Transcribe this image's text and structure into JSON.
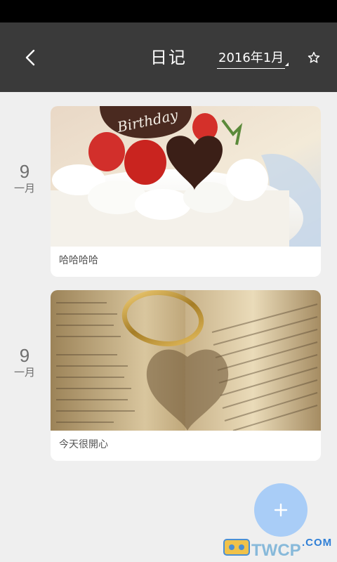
{
  "header": {
    "title": "日记",
    "month": "2016年1月"
  },
  "entries": [
    {
      "day": "9",
      "month": "一月",
      "caption": "哈哈哈哈",
      "photo": "birthday-cake-photo"
    },
    {
      "day": "9",
      "month": "一月",
      "caption": "今天很開心",
      "photo": "ring-on-book-photo"
    }
  ],
  "watermark": {
    "text": "TWCP",
    "suffix": ".COM"
  },
  "colors": {
    "appbar": "#3a3a3a",
    "background": "#efefef",
    "fab": "#a9cdf7",
    "date_text": "#6e6e6e"
  }
}
